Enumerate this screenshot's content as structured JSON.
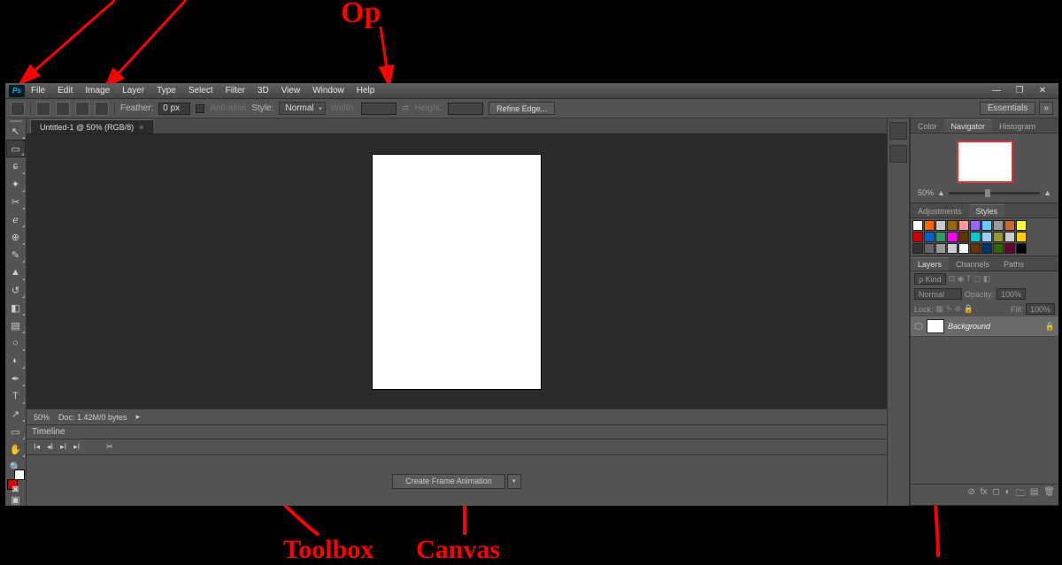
{
  "annotations": {
    "top": "Op",
    "toolbox": "Toolbox",
    "canvas": "Canvas"
  },
  "menubar": {
    "logo": "Ps",
    "items": [
      "File",
      "Edit",
      "Image",
      "Layer",
      "Type",
      "Select",
      "Filter",
      "3D",
      "View",
      "Window",
      "Help"
    ]
  },
  "window_controls": {
    "min": "—",
    "restore": "❐",
    "close": "✕"
  },
  "optionsbar": {
    "feather_label": "Feather:",
    "feather_value": "0 px",
    "antialias_label": "Anti-alias",
    "style_label": "Style:",
    "style_value": "Normal",
    "width_label": "Width:",
    "height_label": "Height:",
    "refine_label": "Refine Edge...",
    "workspace": "Essentials",
    "workspace_menu": "»"
  },
  "document": {
    "tab_label": "Untitled-1 @ 50% (RGB/8)",
    "zoom": "50%",
    "doc_info": "Doc: 1.42M/0 bytes",
    "status_arrow": "▸"
  },
  "timeline": {
    "title": "Timeline",
    "create_btn": "Create Frame Animation",
    "play_first": "I◂",
    "play_prev": "◂I",
    "play": "▸I",
    "play_last": "▸I",
    "extra": "✂"
  },
  "panels": {
    "color_tab": "Color",
    "navigator_tab": "Navigator",
    "histogram_tab": "Histogram",
    "nav_zoom": "50%",
    "adjustments_tab": "Adjustments",
    "styles_tab": "Styles",
    "layers_tab": "Layers",
    "channels_tab": "Channels",
    "paths_tab": "Paths",
    "kind_label": "ρ Kind",
    "blend_value": "Normal",
    "opacity_label": "Opacity:",
    "opacity_value": "100%",
    "lock_label": "Lock:",
    "fill_label": "Fill:",
    "fill_value": "100%",
    "layer_name": "Background"
  },
  "swatch_colors": [
    "#fff",
    "#f60",
    "#ccc",
    "#960",
    "#f99",
    "#96f",
    "#6cf",
    "#999",
    "#c63",
    "#ff3",
    "#c00",
    "#06c",
    "#396",
    "#f0f",
    "#630",
    "#0cc",
    "#9cf",
    "#993",
    "#ccc",
    "#fc0",
    "#333",
    "#666",
    "#999",
    "#ccc",
    "#fff",
    "#630",
    "#036",
    "#360",
    "#603",
    "#000"
  ],
  "tools": [
    {
      "n": "move-tool",
      "g": "↖"
    },
    {
      "n": "marquee-tool",
      "g": "▭",
      "sel": true
    },
    {
      "n": "lasso-tool",
      "g": "ɕ"
    },
    {
      "n": "quick-select-tool",
      "g": "✦"
    },
    {
      "n": "crop-tool",
      "g": "✂"
    },
    {
      "n": "eyedropper-tool",
      "g": "ℯ"
    },
    {
      "n": "healing-tool",
      "g": "⊕"
    },
    {
      "n": "brush-tool",
      "g": "✎"
    },
    {
      "n": "stamp-tool",
      "g": "▲"
    },
    {
      "n": "history-brush-tool",
      "g": "↺"
    },
    {
      "n": "eraser-tool",
      "g": "◧"
    },
    {
      "n": "gradient-tool",
      "g": "▤"
    },
    {
      "n": "blur-tool",
      "g": "○"
    },
    {
      "n": "dodge-tool",
      "g": "◐"
    },
    {
      "n": "pen-tool",
      "g": "✒"
    },
    {
      "n": "type-tool",
      "g": "T"
    },
    {
      "n": "path-select-tool",
      "g": "↗"
    },
    {
      "n": "shape-tool",
      "g": "▭"
    },
    {
      "n": "hand-tool",
      "g": "✋"
    },
    {
      "n": "zoom-tool",
      "g": "🔍"
    }
  ]
}
